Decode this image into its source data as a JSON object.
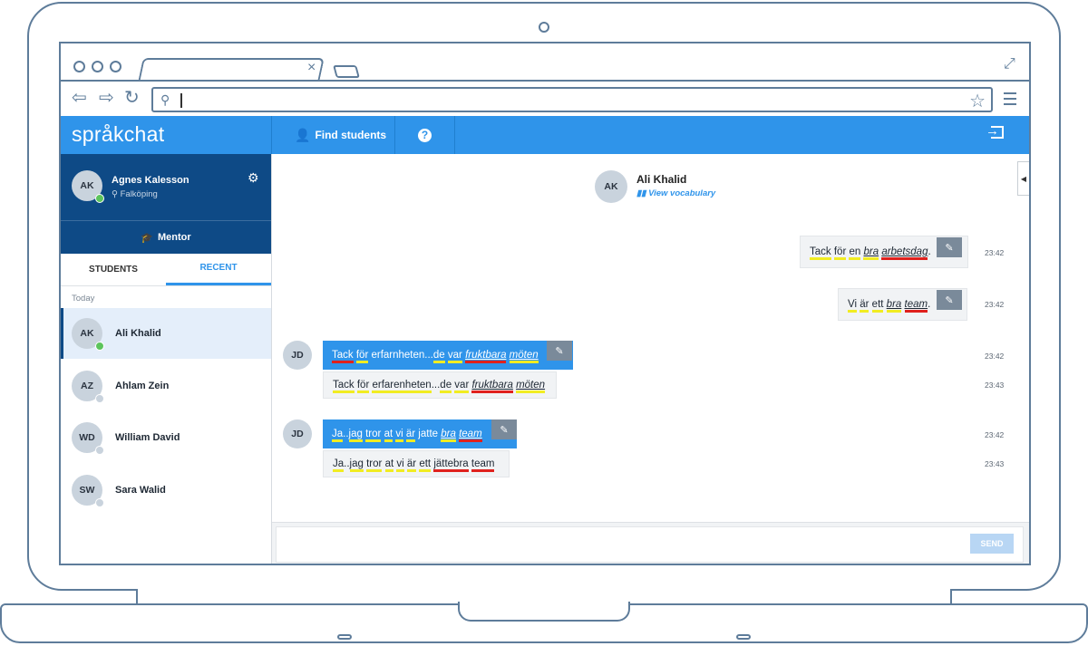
{
  "browser": {
    "tab_close": "×",
    "search_icon": "magnifier-icon",
    "url_value": ""
  },
  "app": {
    "logo": "språkchat",
    "find_students": "Find students",
    "help": "?"
  },
  "profile": {
    "initials": "AK",
    "name": "Agnes Kalesson",
    "location": "Falköping",
    "role": "Mentor"
  },
  "tabs": [
    "STUDENTS",
    "RECENT"
  ],
  "section_label": "Today",
  "contacts": [
    {
      "initials": "AK",
      "name": "Ali Khalid",
      "online": true
    },
    {
      "initials": "AZ",
      "name": "Ahlam Zein",
      "online": false
    },
    {
      "initials": "WD",
      "name": "William David",
      "online": false
    },
    {
      "initials": "SW",
      "name": "Sara Walid",
      "online": false
    }
  ],
  "chat": {
    "initials": "AK",
    "name": "Ali Khalid",
    "view_vocabulary": "View vocabulary",
    "sender_initials": "JD",
    "times": [
      "23:42",
      "23:42",
      "23:42",
      "23:43",
      "23:42",
      "23:43"
    ]
  },
  "composer": {
    "placeholder": "",
    "send": "SEND"
  },
  "colors": {
    "accent": "#2f94ea",
    "navy": "#0e4a86",
    "highlight_yellow": "#f1ec22",
    "highlight_red": "#e0211d",
    "online": "#5cc45c"
  }
}
